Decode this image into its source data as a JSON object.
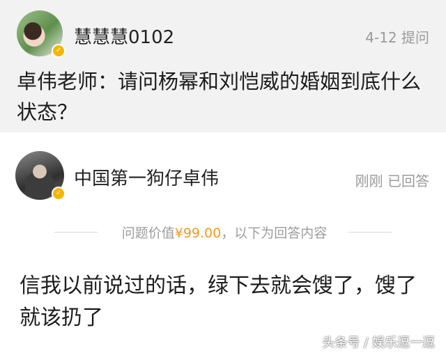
{
  "question": {
    "username": "慧慧慧0102",
    "meta": "4-12 提问",
    "text": "卓伟老师：请问杨幂和刘恺威的婚姻到底什么状态？"
  },
  "answer": {
    "username": "中国第一狗仔卓伟",
    "meta": "刚刚 已回答",
    "price_prefix": "问题价值",
    "price_value": "¥99.00",
    "price_suffix": "，以下为回答内容",
    "text": "信我以前说过的话，绿下去就会馊了，馊了就该扔了"
  },
  "watermark": "头条号 / 娱乐逗一逗",
  "colors": {
    "price_accent": "#f29b1d",
    "verified_badge": "#f7b500",
    "question_bg": "#f2f2f2"
  },
  "icons": {
    "verified": "verified-badge-icon"
  }
}
